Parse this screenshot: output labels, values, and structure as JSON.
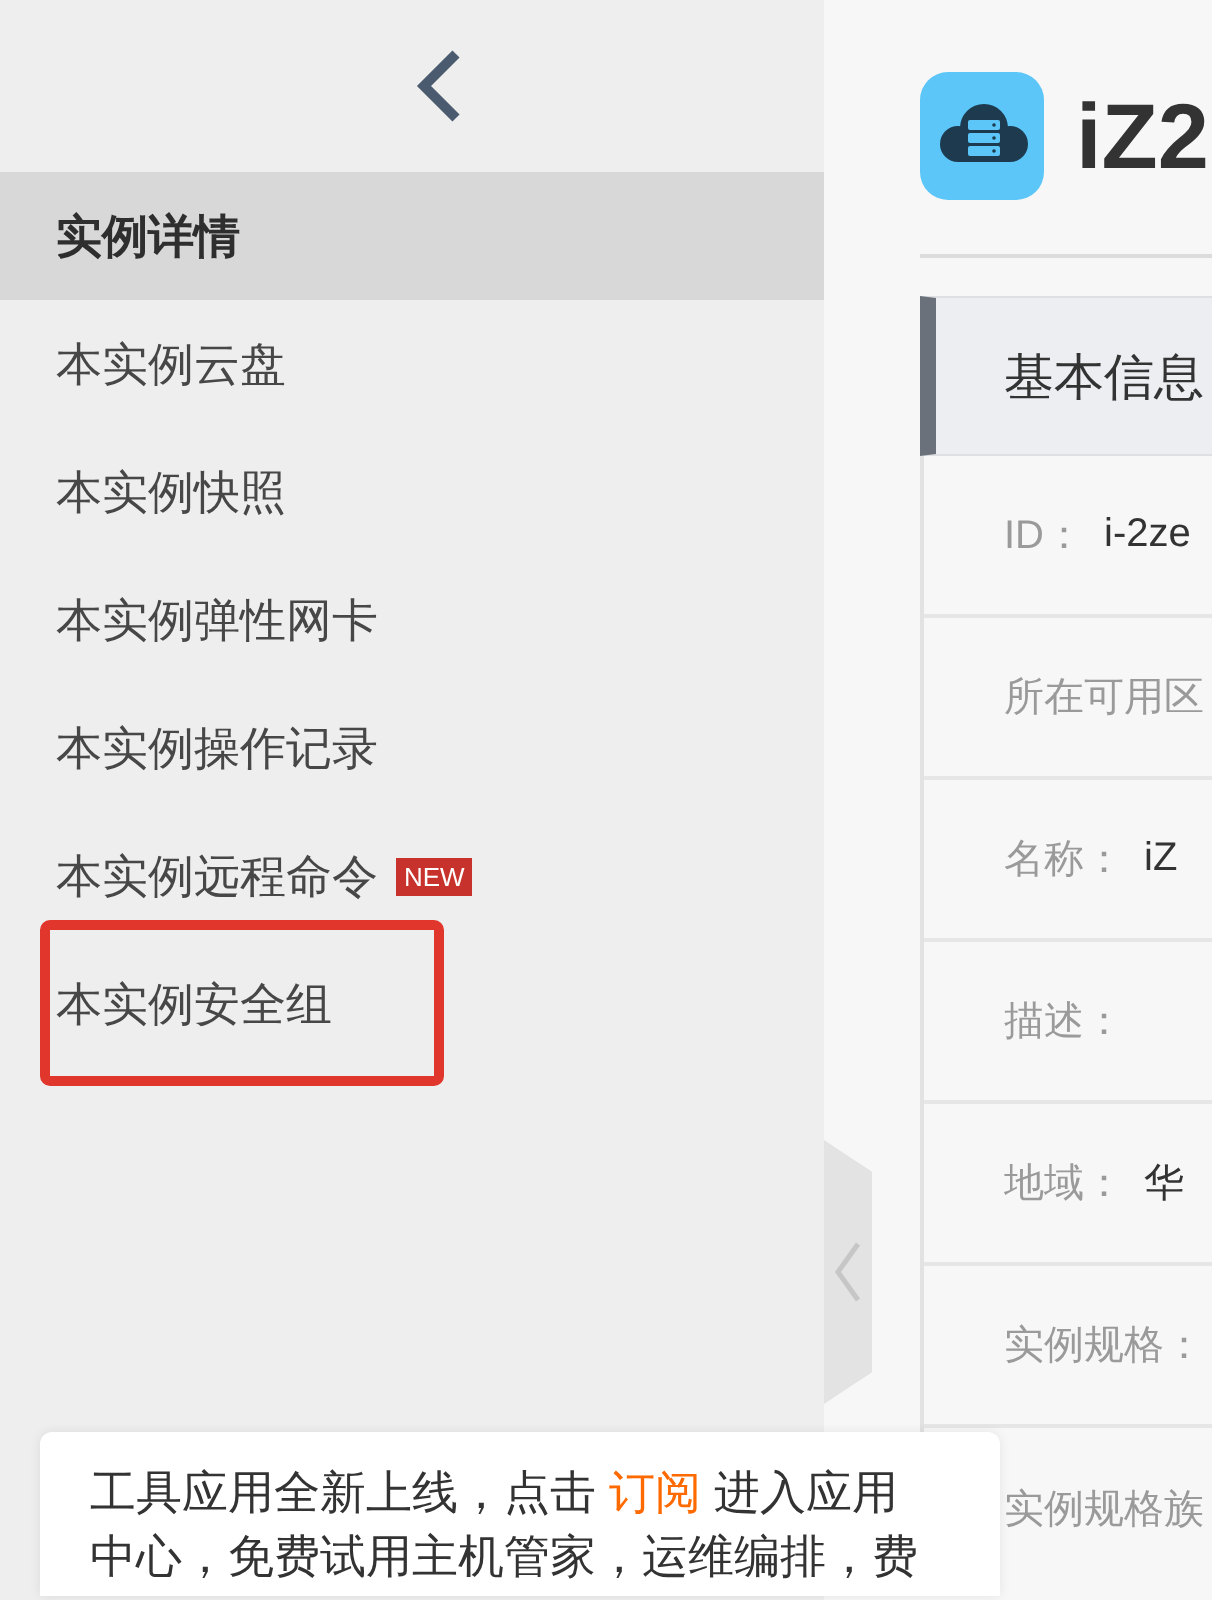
{
  "sidebar": {
    "items": [
      {
        "label": "实例详情",
        "selected": true,
        "highlighted": false
      },
      {
        "label": "本实例云盘",
        "selected": false,
        "highlighted": false
      },
      {
        "label": "本实例快照",
        "selected": false,
        "highlighted": false
      },
      {
        "label": "本实例弹性网卡",
        "selected": false,
        "highlighted": false
      },
      {
        "label": "本实例操作记录",
        "selected": false,
        "highlighted": false
      },
      {
        "label": "本实例远程命令",
        "selected": false,
        "highlighted": false,
        "badge": "NEW"
      },
      {
        "label": "本实例安全组",
        "selected": false,
        "highlighted": true
      }
    ]
  },
  "instance": {
    "title": "iZ2"
  },
  "info_card": {
    "title": "基本信息",
    "rows": [
      {
        "label": "ID：",
        "value": "i-2ze"
      },
      {
        "label": "所在可用区"
      },
      {
        "label": "名称：",
        "value": "iZ"
      },
      {
        "label": "描述："
      },
      {
        "label": "地域：",
        "value": "华"
      },
      {
        "label": "实例规格："
      },
      {
        "label": "实例规格族"
      }
    ]
  },
  "notice": {
    "text_before": "工具应用全新上线，点击",
    "link": "订阅",
    "text_after": "进入应用中心，免费试用主机管家，运维编排，费"
  }
}
